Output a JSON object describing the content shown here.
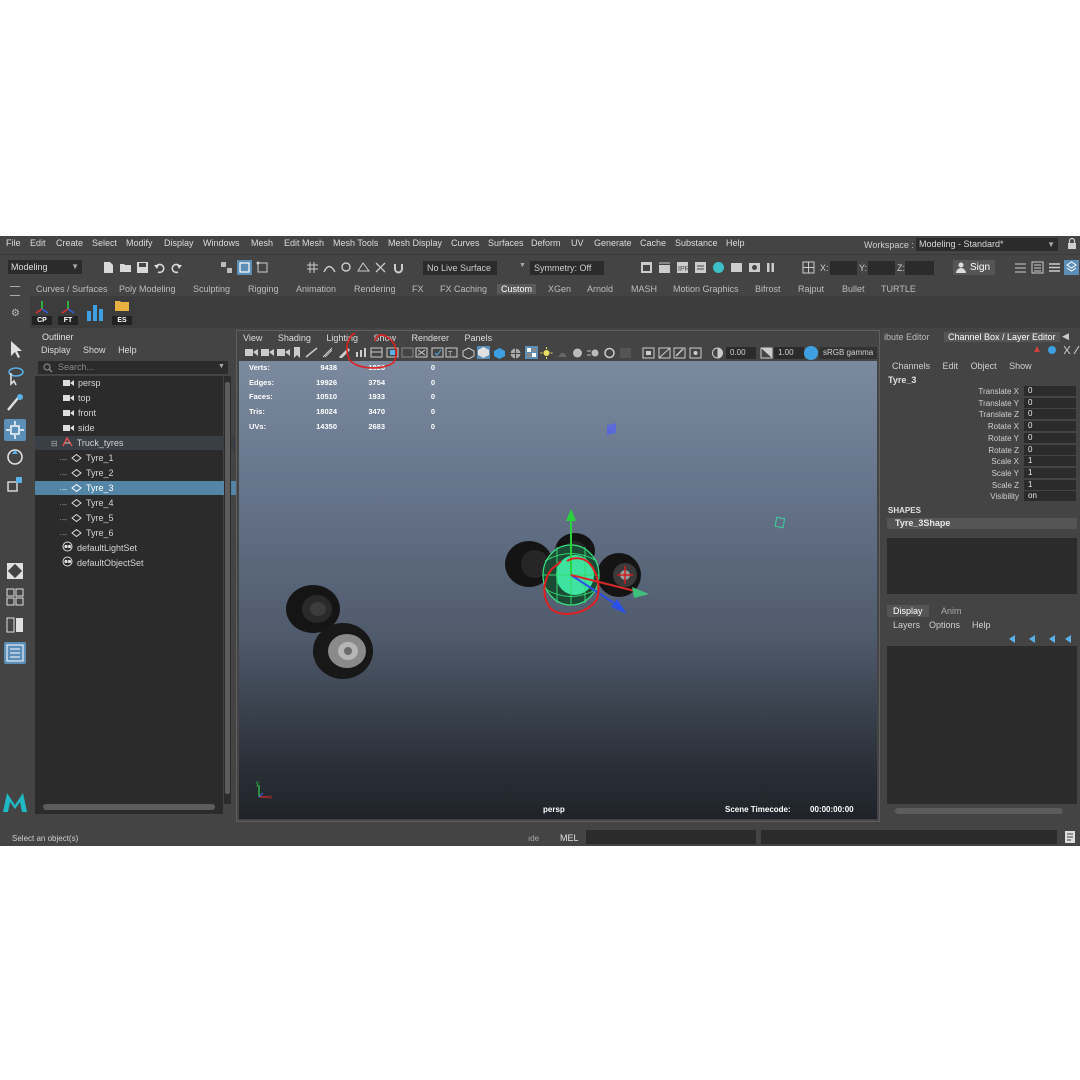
{
  "menu": [
    "File",
    "Edit",
    "Create",
    "Select",
    "Modify",
    "Display",
    "Windows",
    "Mesh",
    "Edit Mesh",
    "Mesh Tools",
    "Mesh Display",
    "Curves",
    "Surfaces",
    "Deform",
    "UV",
    "Generate",
    "Cache",
    "Substance",
    "Help"
  ],
  "workspace": {
    "label": "Workspace :",
    "value": "Modeling - Standard*"
  },
  "status": {
    "mode": "Modeling",
    "live_surface": "No Live Surface",
    "symmetry": "Symmetry: Off",
    "x_label": "X:",
    "y_label": "Y:",
    "z_label": "Z:",
    "sign_in": "Sign"
  },
  "shelf_tabs": [
    "Curves / Surfaces",
    "Poly Modeling",
    "Sculpting",
    "Rigging",
    "Animation",
    "Rendering",
    "FX",
    "FX Caching",
    "Custom",
    "XGen",
    "Arnold",
    "MASH",
    "Motion Graphics",
    "Bifrost",
    "Rajput",
    "Bullet",
    "TURTLE"
  ],
  "shelf_buttons": [
    "CP",
    "FT",
    "",
    "ES"
  ],
  "outliner": {
    "title": "Outliner",
    "menus": [
      "Display",
      "Show",
      "Help"
    ],
    "search_placeholder": "Search...",
    "items": [
      "persp",
      "top",
      "front",
      "side",
      "Truck_tyres",
      "Tyre_1",
      "Tyre_2",
      "Tyre_3",
      "Tyre_4",
      "Tyre_5",
      "Tyre_6",
      "defaultLightSet",
      "defaultObjectSet"
    ]
  },
  "viewport": {
    "menus": [
      "View",
      "Shading",
      "Lighting",
      "Show",
      "Renderer",
      "Panels"
    ],
    "exposure": "0.00",
    "gamma": "1.00",
    "color_space": "sRGB gamma",
    "camera": "persp",
    "timecode_label": "Scene Timecode:",
    "timecode": "00:00:00:00",
    "hud": [
      {
        "label": "Verts:",
        "total": "9438",
        "selected": "1826",
        "comp": "0"
      },
      {
        "label": "Edges:",
        "total": "19926",
        "selected": "3754",
        "comp": "0"
      },
      {
        "label": "Faces:",
        "total": "10510",
        "selected": "1933",
        "comp": "0"
      },
      {
        "label": "Tris:",
        "total": "18024",
        "selected": "3470",
        "comp": "0"
      },
      {
        "label": "UVs:",
        "total": "14350",
        "selected": "2683",
        "comp": "0"
      }
    ]
  },
  "channel_box": {
    "tab_attr": "ibute Editor",
    "tab_channel": "Channel Box / Layer Editor",
    "menus": [
      "Channels",
      "Edit",
      "Object",
      "Show"
    ],
    "object": "Tyre_3",
    "attributes": [
      {
        "name": "Translate X",
        "value": "0"
      },
      {
        "name": "Translate Y",
        "value": "0"
      },
      {
        "name": "Translate Z",
        "value": "0"
      },
      {
        "name": "Rotate X",
        "value": "0"
      },
      {
        "name": "Rotate Y",
        "value": "0"
      },
      {
        "name": "Rotate Z",
        "value": "0"
      },
      {
        "name": "Scale X",
        "value": "1"
      },
      {
        "name": "Scale Y",
        "value": "1"
      },
      {
        "name": "Scale Z",
        "value": "1"
      },
      {
        "name": "Visibility",
        "value": "on"
      }
    ],
    "shapes_label": "SHAPES",
    "shape": "Tyre_3Shape",
    "layer_tabs": [
      "Display",
      "Anim"
    ],
    "layer_menus": [
      "Layers",
      "Options",
      "Help"
    ]
  },
  "help_line": "Select an object(s)",
  "cmd_lang": "MEL",
  "cmd_partial": "ıde",
  "colors": {
    "accent": "#5285a6",
    "bg": "#444444",
    "field": "#2b2b2b",
    "annotation": "#e02020"
  }
}
